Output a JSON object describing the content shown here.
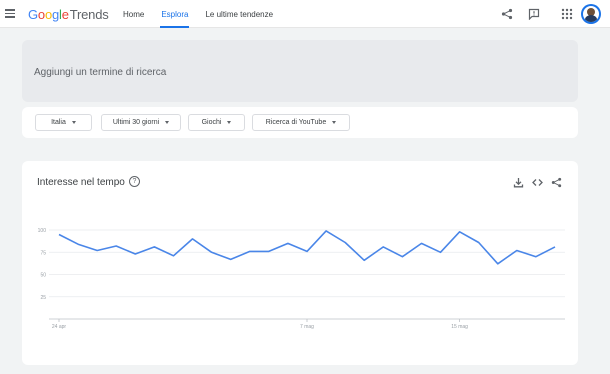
{
  "header": {
    "logo_google_letters": [
      {
        "ch": "G",
        "color": "#4285f4"
      },
      {
        "ch": "o",
        "color": "#ea4335"
      },
      {
        "ch": "o",
        "color": "#fbbc05"
      },
      {
        "ch": "g",
        "color": "#4285f4"
      },
      {
        "ch": "l",
        "color": "#34a853"
      },
      {
        "ch": "e",
        "color": "#ea4335"
      }
    ],
    "logo_trends": "Trends",
    "nav": [
      {
        "label": "Home",
        "active": false
      },
      {
        "label": "Esplora",
        "active": true
      },
      {
        "label": "Le ultime tendenze",
        "active": false
      }
    ],
    "icons": [
      "menu-icon",
      "share-icon",
      "feedback-icon",
      "apps-icon",
      "avatar"
    ]
  },
  "search": {
    "placeholder": "Aggiungi un termine di ricerca"
  },
  "filters": [
    {
      "label": "Italia"
    },
    {
      "label": "Ultimi 30 giorni"
    },
    {
      "label": "Giochi"
    },
    {
      "label": "Ricerca di YouTube"
    }
  ],
  "chart_card": {
    "title": "Interesse nel tempo",
    "icons": [
      "help-icon",
      "download-icon",
      "embed-icon",
      "share-icon"
    ]
  },
  "colors": {
    "accent": "#1a73e8",
    "line": "#4a86e8",
    "grid": "#e8eaed"
  },
  "chart_data": {
    "type": "line",
    "title": "",
    "xlabel": "",
    "ylabel": "",
    "ylim": [
      0,
      100
    ],
    "yticks": [
      100,
      75,
      50,
      25
    ],
    "grid": true,
    "x_tick_labels": [
      {
        "index": 0,
        "label": "24 apr"
      },
      {
        "index": 13,
        "label": "7 mag"
      },
      {
        "index": 21,
        "label": "15 mag"
      },
      {
        "index": 29,
        "label": "23 mag"
      }
    ],
    "series": [
      {
        "values": [
          95,
          84,
          77,
          82,
          73,
          81,
          71,
          90,
          75,
          67,
          76,
          76,
          85,
          76,
          99,
          86,
          66,
          81,
          70,
          85,
          75,
          98,
          86,
          62,
          77,
          70,
          81
        ]
      }
    ]
  }
}
